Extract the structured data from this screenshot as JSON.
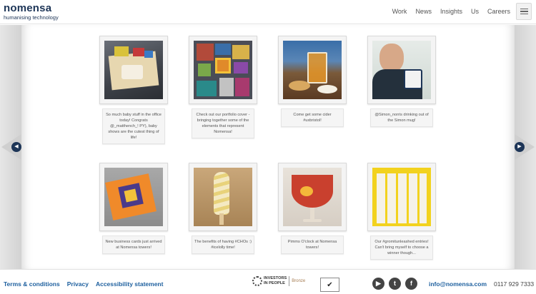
{
  "header": {
    "logo_text": "nomensa",
    "logo_tagline": "humanising technology",
    "nav": [
      "Work",
      "News",
      "Insights",
      "Us",
      "Careers"
    ],
    "menu_icon": "hamburger-icon"
  },
  "carousel": {
    "prev_icon": "chevron-left-icon",
    "next_icon": "chevron-right-icon",
    "cards": [
      {
        "caption": "So much baby stuff in the office today! Congrats @_matthench_! PY), baby shows are the cutest thing of life!"
      },
      {
        "caption": "Check out our portfolio cover - bringing together some of the elements that represent Nomensa!"
      },
      {
        "caption": "Come get some cider #uxbristol!"
      },
      {
        "caption": "@Simon_norris drinking out of the Simon mug!"
      },
      {
        "caption": "New business cards just arrived at Nomensa towers!"
      },
      {
        "caption": "The benefits of having #CHOs :) #icelolly time!"
      },
      {
        "caption": "Pimms O'clock at Nomensa towers!"
      },
      {
        "caption": "Our #gromitunleashed entries! Can't bring myself to choose a winner though..."
      }
    ]
  },
  "footer": {
    "links": [
      "Terms & conditions",
      "Privacy",
      "Accessibility statement"
    ],
    "iip_line1": "INVESTORS",
    "iip_line2": "IN PEOPLE",
    "iip_level": "Bronze",
    "social": [
      "youtube-icon",
      "twitter-icon",
      "facebook-icon"
    ],
    "email": "info@nomensa.com",
    "phone": "0117 929 7333"
  },
  "colors": {
    "brand_navy": "#1d3557",
    "link_blue": "#1d5f9e"
  }
}
